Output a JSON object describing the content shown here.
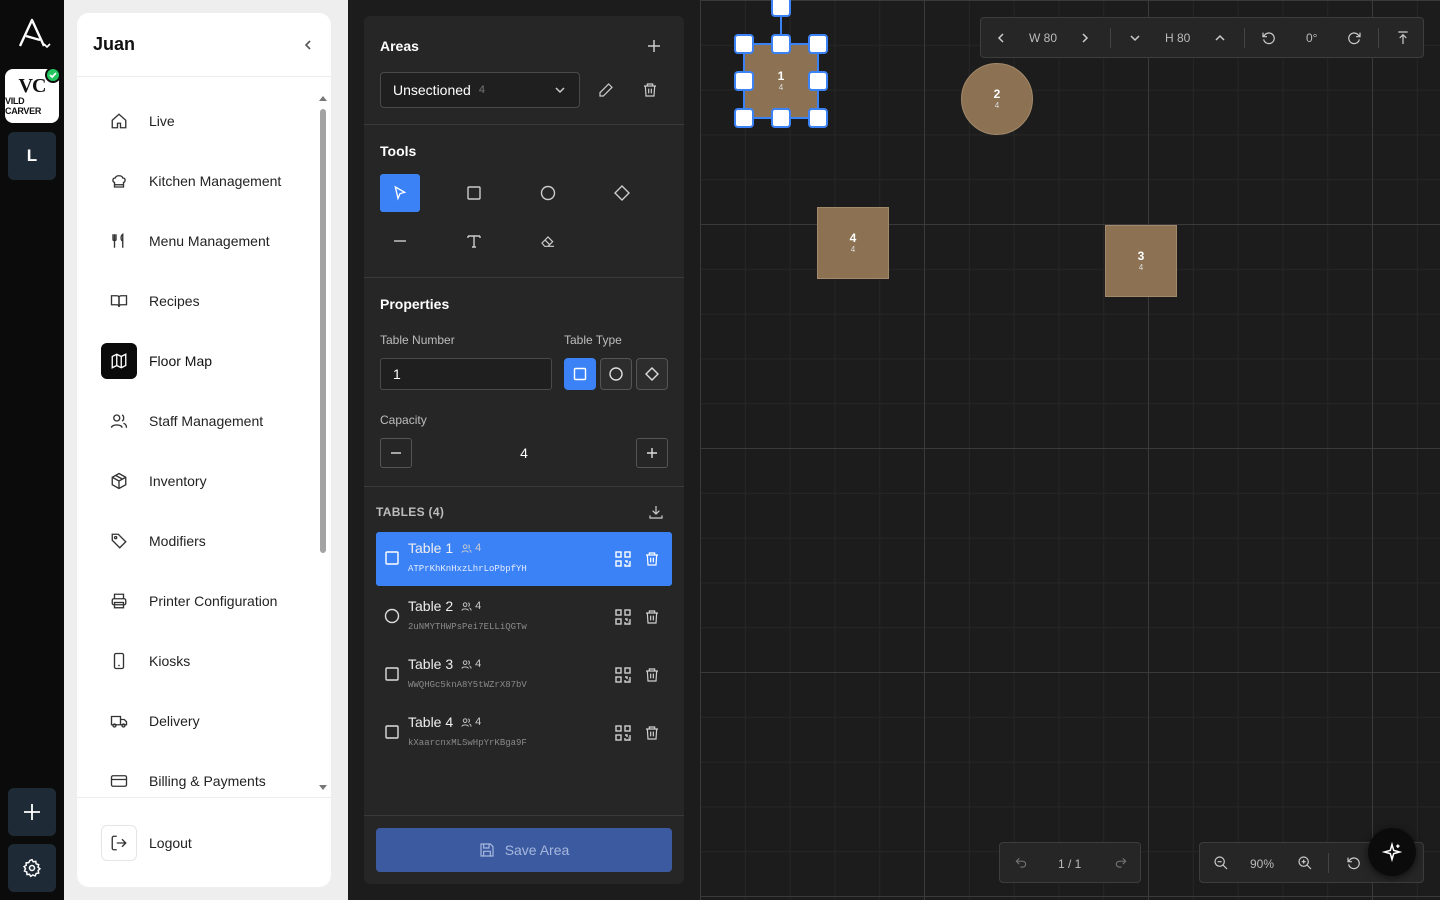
{
  "rail": {
    "brand_mono": "VC",
    "brand_word": "VILD CARVER",
    "tenant_initial": "L"
  },
  "sidebar": {
    "user_name": "Juan",
    "items": [
      {
        "label": "Live",
        "icon": "home-icon"
      },
      {
        "label": "Kitchen Management",
        "icon": "chef-hat-icon"
      },
      {
        "label": "Menu Management",
        "icon": "utensils-icon"
      },
      {
        "label": "Recipes",
        "icon": "book-icon"
      },
      {
        "label": "Floor Map",
        "icon": "map-icon",
        "active": true
      },
      {
        "label": "Staff Management",
        "icon": "users-icon"
      },
      {
        "label": "Inventory",
        "icon": "package-icon"
      },
      {
        "label": "Modifiers",
        "icon": "tag-icon"
      },
      {
        "label": "Printer Configuration",
        "icon": "printer-icon"
      },
      {
        "label": "Kiosks",
        "icon": "tablet-icon"
      },
      {
        "label": "Delivery",
        "icon": "truck-icon"
      },
      {
        "label": "Billing & Payments",
        "icon": "credit-card-icon"
      }
    ],
    "logout_label": "Logout"
  },
  "panel": {
    "areas_title": "Areas",
    "area_selected": "Unsectioned",
    "area_count": "4",
    "tools_title": "Tools",
    "properties_title": "Properties",
    "table_number_label": "Table Number",
    "table_number_value": "1",
    "table_type_label": "Table Type",
    "capacity_label": "Capacity",
    "capacity_value": "4",
    "tables_header": "TABLES (4)",
    "tables": [
      {
        "name": "Table 1",
        "capacity": "4",
        "code": "ATPrKhKnHxzLhrLoPbpfYH",
        "shape": "square",
        "active": true
      },
      {
        "name": "Table 2",
        "capacity": "4",
        "code": "2uNMYTHWPsPei7ELLiQGTw",
        "shape": "circle",
        "active": false
      },
      {
        "name": "Table 3",
        "capacity": "4",
        "code": "WWQHGc5knA8Y5tWZrX87bV",
        "shape": "square",
        "active": false
      },
      {
        "name": "Table 4",
        "capacity": "4",
        "code": "kXaarcnxMLSwHpYrKBga9F",
        "shape": "square",
        "active": false
      }
    ],
    "save_label": "Save Area"
  },
  "canvas": {
    "tables": [
      {
        "number": "1",
        "capacity": "4",
        "shape": "square",
        "selected": true
      },
      {
        "number": "2",
        "capacity": "4",
        "shape": "circle"
      },
      {
        "number": "4",
        "capacity": "4",
        "shape": "square"
      },
      {
        "number": "3",
        "capacity": "4",
        "shape": "square"
      }
    ],
    "toolbar": {
      "width": "W 80",
      "height": "H 80",
      "rotation": "0°"
    },
    "pager": "1 / 1",
    "zoom": "90%"
  },
  "colors": {
    "accent": "#3b82f6",
    "table_fill": "#8c7253",
    "canvas_bg": "#1c1c1c",
    "panel_bg": "#262626"
  }
}
